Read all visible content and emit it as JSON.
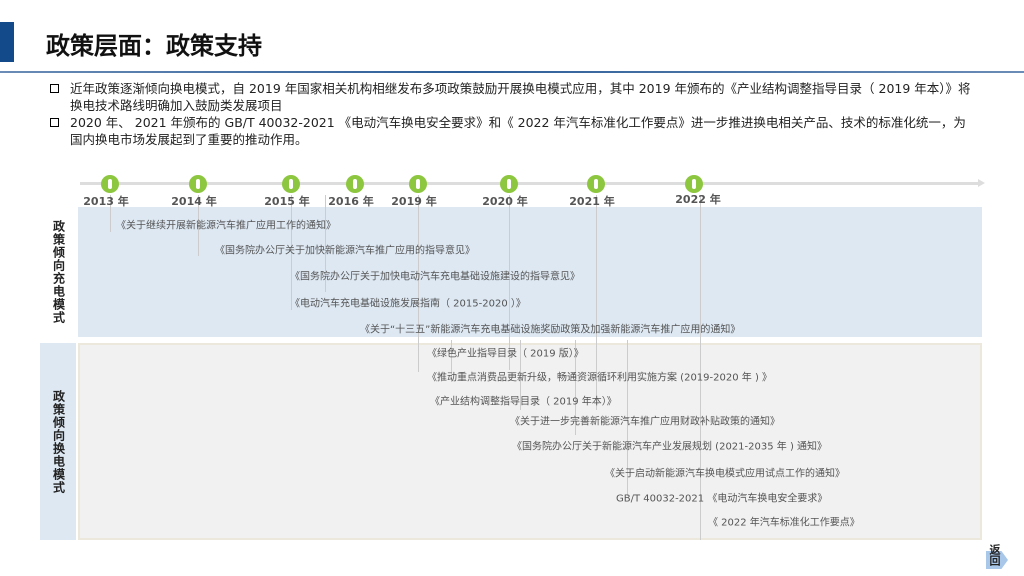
{
  "title": "政策层面：政策支持",
  "bullets": [
    "近年政策逐渐倾向换电模式，自 2019 年国家相关机构相继发布多项政策鼓励开展换电模式应用，其中 2019 年颁布的《产业结构调整指导目录（ 2019 年本）》将换电技术路线明确加入鼓励类发展项目",
    "2020 年、 2021 年颁布的 GB/T 40032-2021 《电动汽车换电安全要求》和《 2022 年汽车标准化工作要点》进一步推进换电相关产品、技术的标准化统一，为国内换电市场发展起到了重要的推动作用。"
  ],
  "timeline": [
    "2013 年",
    "2014 年",
    "2015 年",
    "2016 年",
    "2019 年",
    "2020 年",
    "2021 年",
    "2022 年"
  ],
  "charging": {
    "label": "政策倾向充电模式",
    "policies": [
      "《关于继续开展新能源汽车推广应用工作的通知》",
      "《国务院办公厅关于加快新能源汽车推广应用的指导意见》",
      "《国务院办公厅关于加快电动汽车充电基础设施建设的指导意见》",
      "《电动汽车充电基础设施发展指南（ 2015-2020 ）》",
      "《关于“十三五”新能源汽车充电基础设施奖励政策及加强新能源汽车推广应用的通知》"
    ]
  },
  "swapping": {
    "label": "政策倾向换电模式",
    "policies": [
      "《绿色产业指导目录（ 2019 版）》",
      "《推动重点消费品更新升级，畅通资源循环利用实施方案 (2019-2020 年 ) 》",
      "《产业结构调整指导目录（ 2019 年本）》",
      "《关于进一步完善新能源汽车推广应用财政补贴政策的通知》",
      "《国务院办公厅关于新能源汽车产业发展规划 (2021-2035 年 ) 通知》",
      "《关于启动新能源汽车换电模式应用试点工作的通知》",
      "GB/T 40032-2021 《电动汽车换电安全要求》",
      "《 2022 年汽车标准化工作要点》"
    ]
  },
  "back_label": "返回",
  "colors": {
    "accent": "#134b8a",
    "milestone": "#8dc63f",
    "band": "#dde8f3"
  }
}
